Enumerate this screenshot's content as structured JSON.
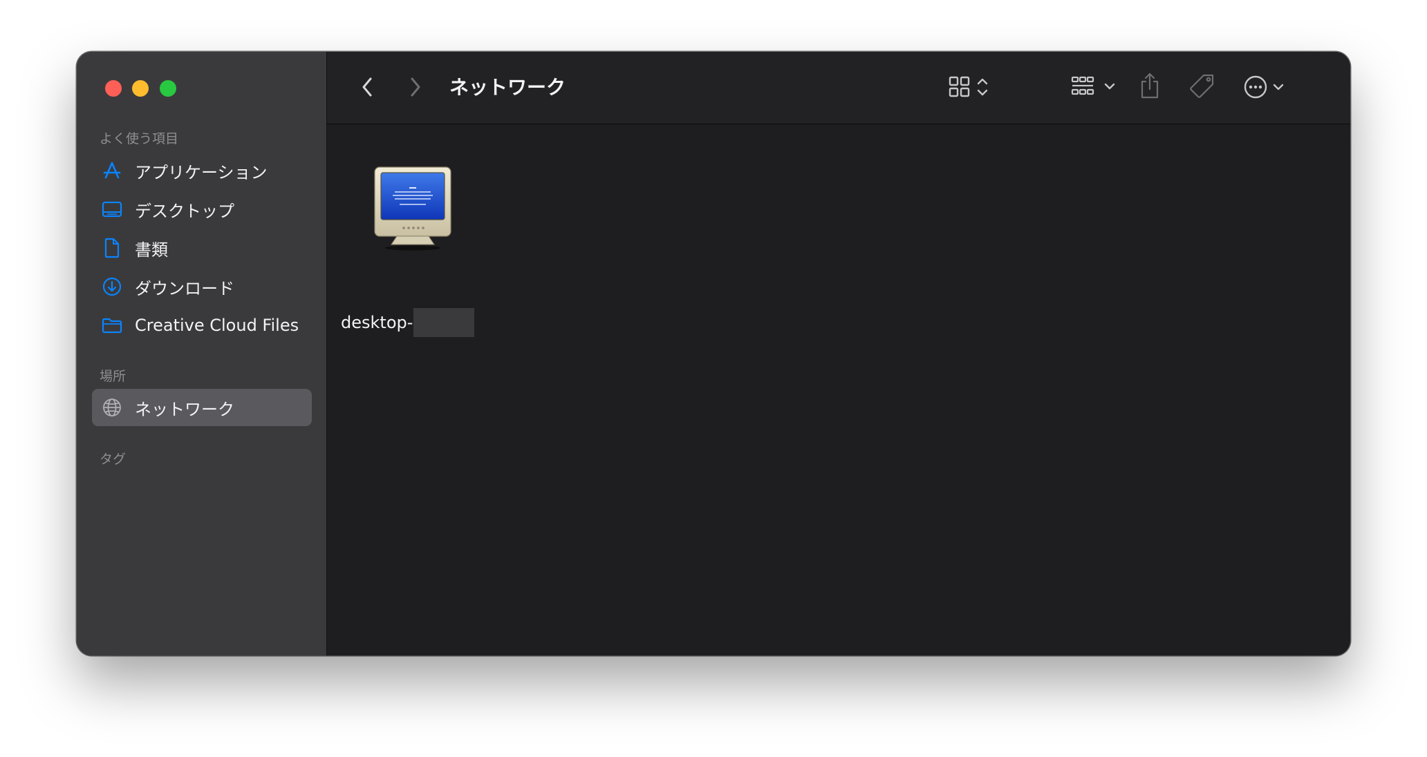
{
  "window": {
    "title": "ネットワーク"
  },
  "sidebar": {
    "favorites_label": "よく使う項目",
    "favorites": [
      {
        "label": "アプリケーション",
        "icon": "app-store-icon"
      },
      {
        "label": "デスクトップ",
        "icon": "desktop-icon"
      },
      {
        "label": "書類",
        "icon": "document-icon"
      },
      {
        "label": "ダウンロード",
        "icon": "download-icon"
      },
      {
        "label": "Creative Cloud Files",
        "icon": "folder-icon"
      }
    ],
    "locations_label": "場所",
    "locations": [
      {
        "label": "ネットワーク",
        "icon": "network-globe-icon",
        "selected": true
      }
    ],
    "tags_label": "タグ"
  },
  "files": [
    {
      "name": "desktop-",
      "icon": "computer-monitor-icon"
    }
  ],
  "colors": {
    "accent": "#0a84ff",
    "sidebar_bg": "#3a3a3c",
    "content_bg": "#1e1e20",
    "close": "#fe5f57",
    "minimize": "#febc2e",
    "zoom": "#28c840"
  }
}
